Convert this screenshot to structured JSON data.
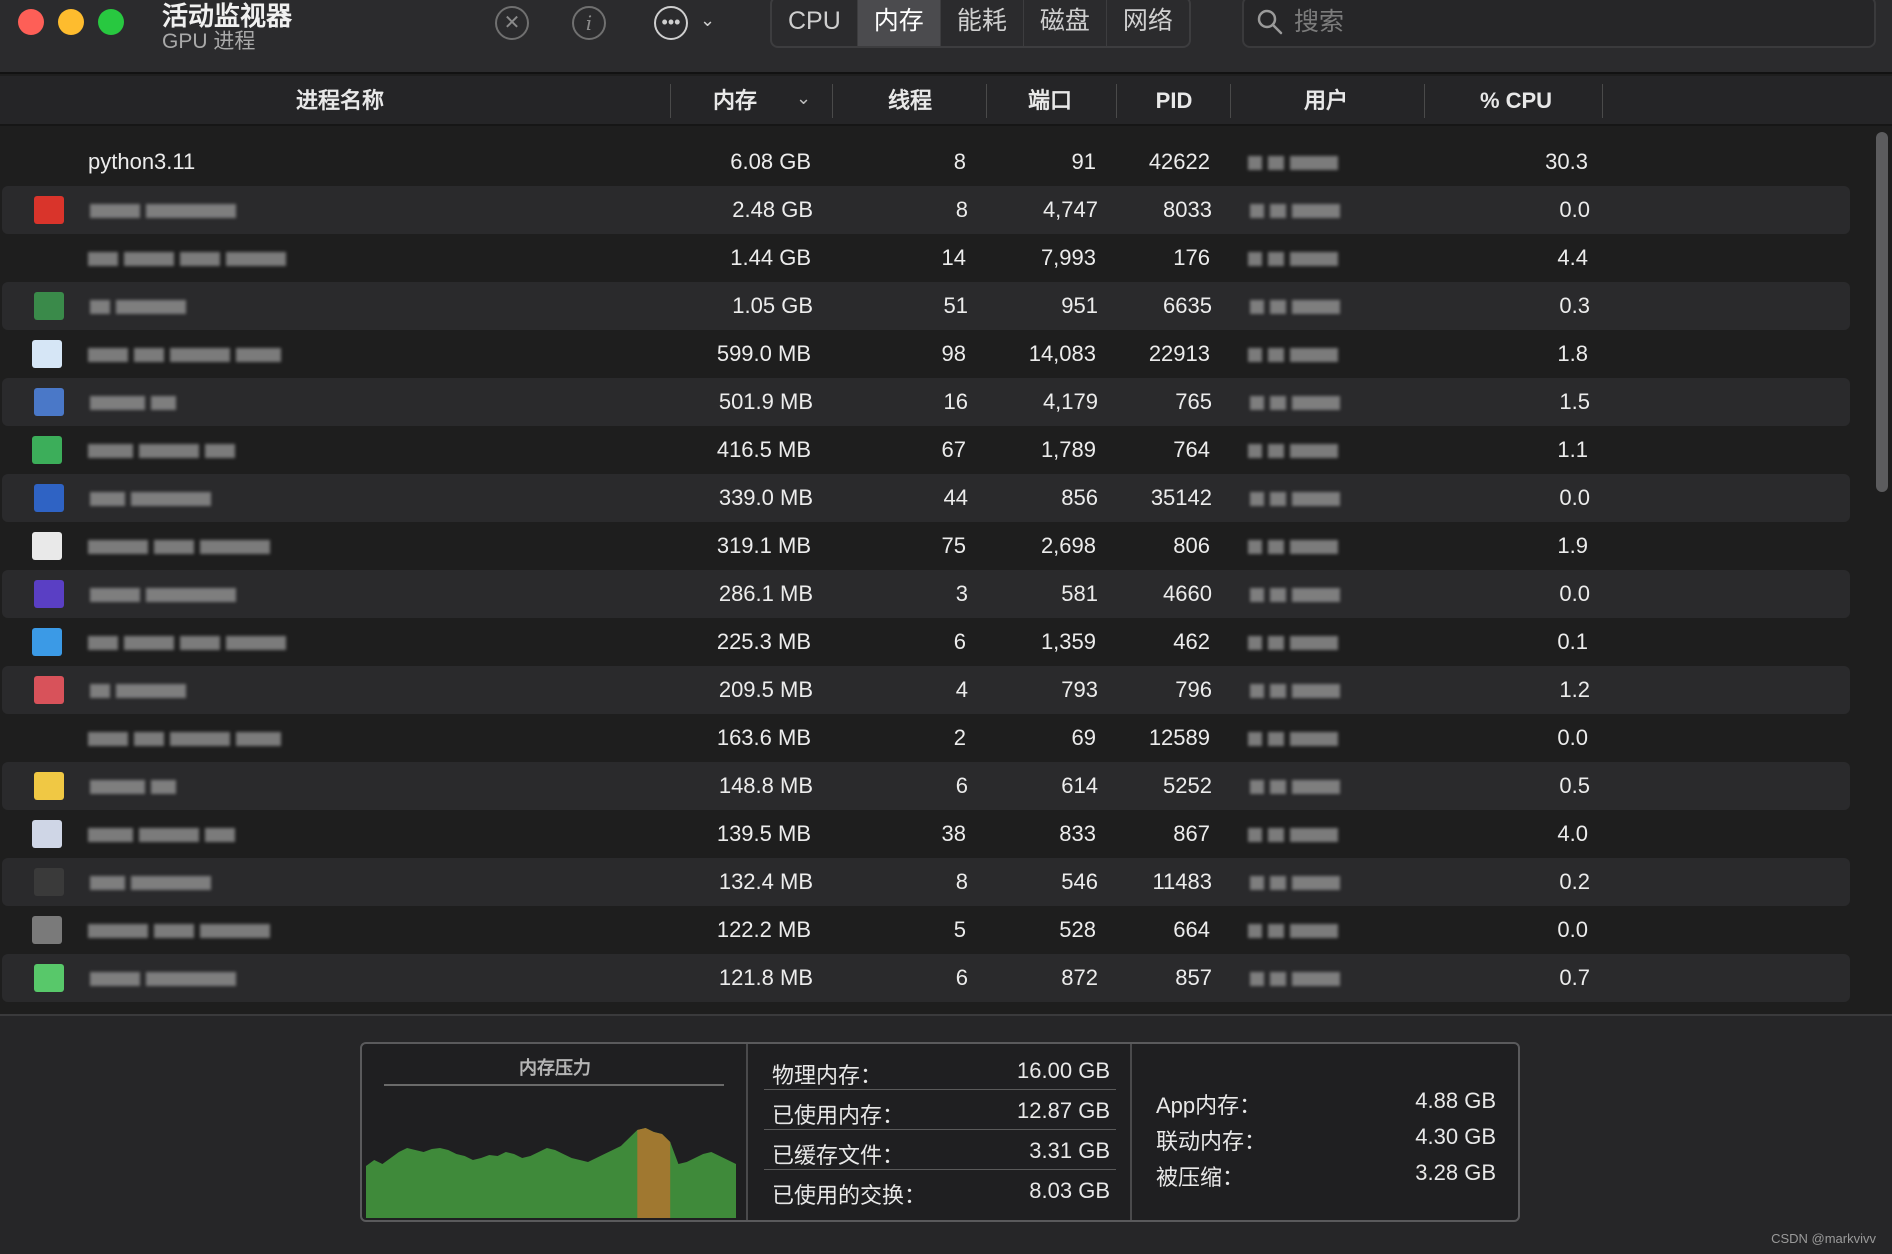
{
  "window": {
    "title": "活动监视器",
    "subtitle": "GPU 进程"
  },
  "toolbar": {
    "tabs": [
      {
        "label": "CPU",
        "active": false
      },
      {
        "label": "内存",
        "active": true
      },
      {
        "label": "能耗",
        "active": false
      },
      {
        "label": "磁盘",
        "active": false
      },
      {
        "label": "网络",
        "active": false
      }
    ],
    "search_placeholder": "搜索",
    "icons": [
      "stop-process-icon",
      "info-icon",
      "more-actions-icon",
      "chevron-down-icon",
      "search-icon"
    ]
  },
  "table": {
    "columns": [
      "进程名称",
      "内存",
      "线程",
      "端口",
      "PID",
      "用户",
      "% CPU"
    ],
    "sort_column": "内存",
    "rows": [
      {
        "name": "python3.11",
        "mem": "6.08 GB",
        "threads": "8",
        "ports": "91",
        "pid": "42622",
        "cpu": "30.3",
        "icon_color": ""
      },
      {
        "name": "",
        "mem": "2.48 GB",
        "threads": "8",
        "ports": "4,747",
        "pid": "8033",
        "cpu": "0.0",
        "icon_color": "#d9342b"
      },
      {
        "name": "",
        "mem": "1.44 GB",
        "threads": "14",
        "ports": "7,993",
        "pid": "176",
        "cpu": "4.4",
        "icon_color": ""
      },
      {
        "name": "",
        "mem": "1.05 GB",
        "threads": "51",
        "ports": "951",
        "pid": "6635",
        "cpu": "0.3",
        "icon_color": "#3a8a4a"
      },
      {
        "name": "",
        "mem": "599.0 MB",
        "threads": "98",
        "ports": "14,083",
        "pid": "22913",
        "cpu": "1.8",
        "icon_color": "#d6e6f6"
      },
      {
        "name": "",
        "mem": "501.9 MB",
        "threads": "16",
        "ports": "4,179",
        "pid": "765",
        "cpu": "1.5",
        "icon_color": "#4a78c8"
      },
      {
        "name": "",
        "mem": "416.5 MB",
        "threads": "67",
        "ports": "1,789",
        "pid": "764",
        "cpu": "1.1",
        "icon_color": "#3cae5a"
      },
      {
        "name": "",
        "mem": "339.0 MB",
        "threads": "44",
        "ports": "856",
        "pid": "35142",
        "cpu": "0.0",
        "icon_color": "#2f63c4"
      },
      {
        "name": "",
        "mem": "319.1 MB",
        "threads": "75",
        "ports": "2,698",
        "pid": "806",
        "cpu": "1.9",
        "icon_color": "#e9e9e9"
      },
      {
        "name": "",
        "mem": "286.1 MB",
        "threads": "3",
        "ports": "581",
        "pid": "4660",
        "cpu": "0.0",
        "icon_color": "#5a3fc4"
      },
      {
        "name": "",
        "mem": "225.3 MB",
        "threads": "6",
        "ports": "1,359",
        "pid": "462",
        "cpu": "0.1",
        "icon_color": "#3b9ae6"
      },
      {
        "name": "",
        "mem": "209.5 MB",
        "threads": "4",
        "ports": "793",
        "pid": "796",
        "cpu": "1.2",
        "icon_color": "#d8525a"
      },
      {
        "name": "",
        "mem": "163.6 MB",
        "threads": "2",
        "ports": "69",
        "pid": "12589",
        "cpu": "0.0",
        "icon_color": ""
      },
      {
        "name": "",
        "mem": "148.8 MB",
        "threads": "6",
        "ports": "614",
        "pid": "5252",
        "cpu": "0.5",
        "icon_color": "#f0c844"
      },
      {
        "name": "",
        "mem": "139.5 MB",
        "threads": "38",
        "ports": "833",
        "pid": "867",
        "cpu": "4.0",
        "icon_color": "#cfd6e6"
      },
      {
        "name": "",
        "mem": "132.4 MB",
        "threads": "8",
        "ports": "546",
        "pid": "11483",
        "cpu": "0.2",
        "icon_color": "#3a3a3a"
      },
      {
        "name": "",
        "mem": "122.2 MB",
        "threads": "5",
        "ports": "528",
        "pid": "664",
        "cpu": "0.0",
        "icon_color": "#7a7a7a"
      },
      {
        "name": "",
        "mem": "121.8 MB",
        "threads": "6",
        "ports": "872",
        "pid": "857",
        "cpu": "0.7",
        "icon_color": "#58c86a"
      }
    ]
  },
  "memory": {
    "pressure_title": "内存压力",
    "pressure_colors": {
      "normal": "#3f8a3a",
      "warning": "#a07830"
    },
    "stats": [
      {
        "label": "物理内存：",
        "value": "16.00 GB"
      },
      {
        "label": "已使用内存：",
        "value": "12.87 GB"
      },
      {
        "label": "已缓存文件：",
        "value": "3.31 GB"
      },
      {
        "label": "已使用的交换：",
        "value": "8.03 GB"
      }
    ],
    "app_stats": [
      {
        "label": "App内存：",
        "value": "4.88 GB"
      },
      {
        "label": "联动内存：",
        "value": "4.30 GB"
      },
      {
        "label": "被压缩：",
        "value": "3.28 GB"
      }
    ]
  },
  "watermark": "CSDN @markvivv"
}
